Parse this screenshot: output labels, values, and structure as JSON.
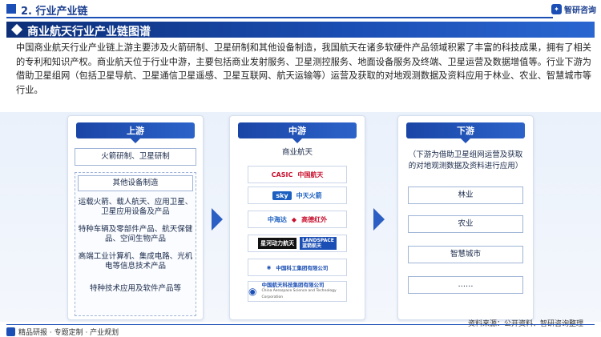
{
  "header": {
    "section_title": "2. 行业产业链",
    "brand": "智研咨询"
  },
  "banner": {
    "title": "商业航天行业产业链图谱"
  },
  "intro": {
    "text": "中国商业航天行业产业链上游主要涉及火箭研制、卫星研制和其他设备制造，我国航天在诸多软硬件产品领域积累了丰富的科技成果，拥有了相关的专利和知识产权。商业航天位于行业中游，主要包括商业发射服务、卫星测控服务、地面设备服务及终端、卫星运营及数据增值等。行业下游为借助卫星组网（包括卫星导航、卫星通信卫星遥感、卫星互联网、航天运输等）运营及获取的对地观测数据及资料应用于林业、农业、智慧城市等行业。"
  },
  "upstream": {
    "title": "上游",
    "rocket_satellite": "火箭研制、卫星研制",
    "other_equipment": "其他设备制造",
    "items": [
      "运载火箭、载人航天、应用卫星、卫星应用设备及产品",
      "特种车辆及零部件产品、航天保健品、空间生物产品",
      "高端工业计算机、集成电路、光机电等信息技术产品",
      "特种技术应用及软件产品等"
    ]
  },
  "midstream": {
    "title": "中游",
    "subtitle": "商业航天",
    "logos": [
      {
        "mark": "CASIC",
        "text": "中国航天",
        "color": "#c8102e"
      },
      {
        "mark": "sky",
        "text": "中天火箭",
        "color": "#1b5fc0"
      },
      {
        "mark": "中海达",
        "text": "",
        "color": "#1b5fc0"
      },
      {
        "mark": "◆",
        "text": "高德红外",
        "color": "#c8102e"
      },
      {
        "mark": "星河动力航天",
        "text": "",
        "color": "#ffffff"
      },
      {
        "mark": "LANDSPACE",
        "text": "蓝箭航天",
        "color": "#ffffff"
      },
      {
        "mark": "◉",
        "text": "中国科工集团有限公司",
        "color": "#1b4fb5"
      },
      {
        "mark": "◉",
        "text": "中国航天科技集团有限公司",
        "color": "#1b4fb5"
      }
    ],
    "logo_subtext": "China Aerospace Science and Technology Corporation"
  },
  "downstream": {
    "title": "下游",
    "note": "（下游为借助卫星组网运营及获取的对地观测数据及资料进行应用）",
    "items": [
      "林业",
      "农业",
      "智慧城市",
      "……"
    ]
  },
  "footer": {
    "left": "精品研报 · 专题定制 · 产业规划",
    "source": "资料来源：公开资料、智研咨询整理"
  },
  "colors": {
    "primary": "#1b4fb5",
    "dark": "#0d2f78"
  }
}
